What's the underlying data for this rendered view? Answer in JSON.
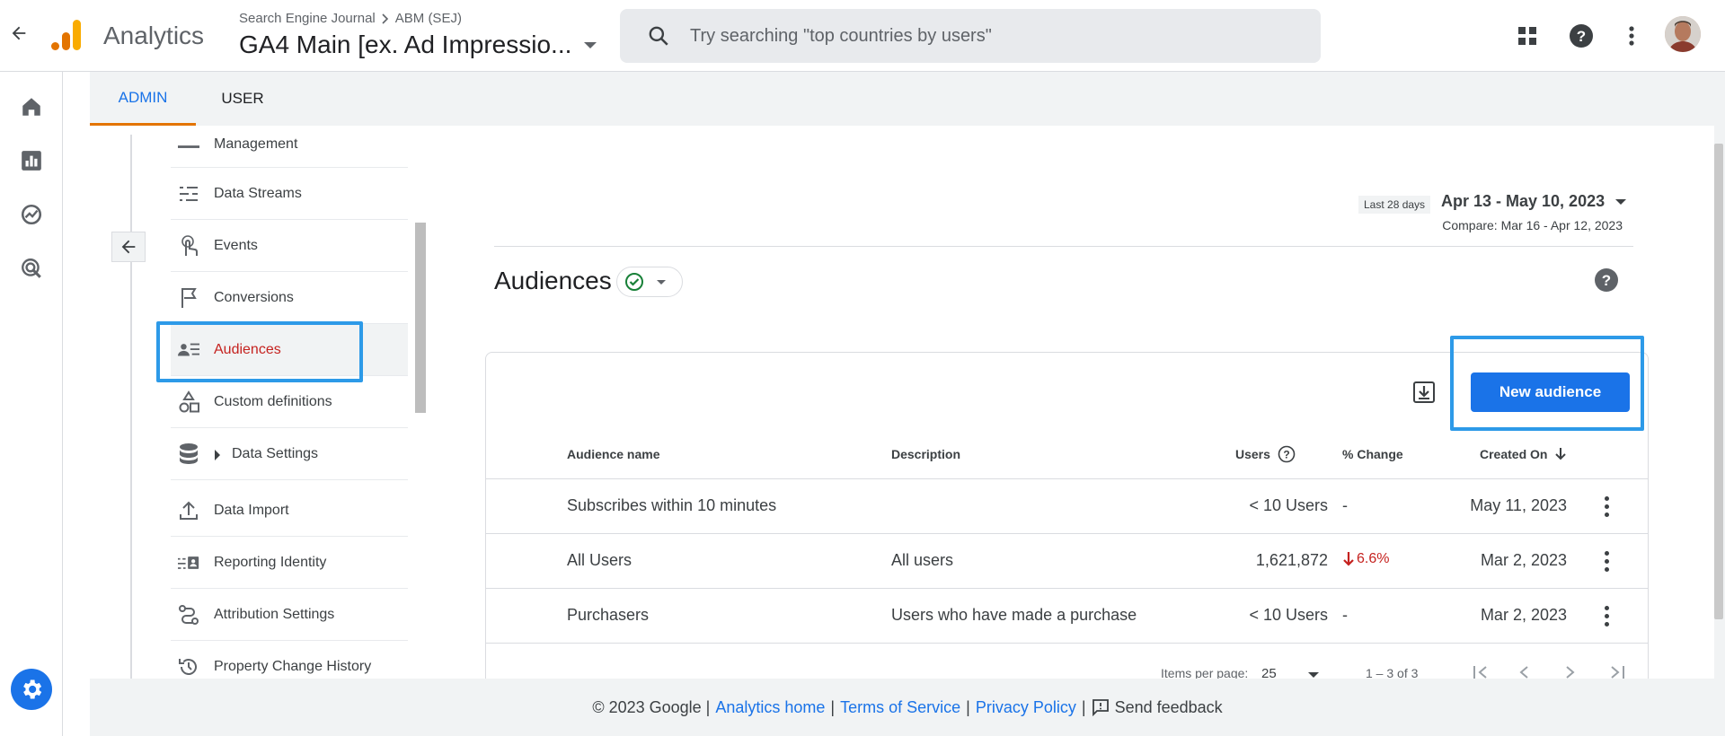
{
  "header": {
    "app_name": "Analytics",
    "breadcrumb_account": "Search Engine Journal",
    "breadcrumb_property": "ABM (SEJ)",
    "property_name": "GA4 Main [ex. Ad Impressio...",
    "search_placeholder": "Try searching \"top countries by users\"",
    "icons": [
      "back-arrow-icon",
      "apps-grid-icon",
      "help-icon",
      "more-vert-icon"
    ]
  },
  "tabs": [
    {
      "label": "ADMIN",
      "active": true
    },
    {
      "label": "USER",
      "active": false
    }
  ],
  "nav": {
    "items": [
      {
        "label": "Management",
        "icon": "management-icon"
      },
      {
        "label": "Data Streams",
        "icon": "data-streams-icon"
      },
      {
        "label": "Events",
        "icon": "touch-icon"
      },
      {
        "label": "Conversions",
        "icon": "flag-icon"
      },
      {
        "label": "Audiences",
        "icon": "audiences-icon",
        "selected": true
      },
      {
        "label": "Custom definitions",
        "icon": "shapes-icon"
      },
      {
        "label": "Data Settings",
        "icon": "database-icon"
      },
      {
        "label": "Data Import",
        "icon": "upload-icon"
      },
      {
        "label": "Reporting Identity",
        "icon": "reporting-identity-icon"
      },
      {
        "label": "Attribution Settings",
        "icon": "attribution-icon"
      },
      {
        "label": "Property Change History",
        "icon": "history-icon"
      }
    ]
  },
  "date": {
    "preset": "Last 28 days",
    "range": "Apr 13 - May 10, 2023",
    "compare": "Compare: Mar 16 - Apr 12, 2023"
  },
  "page": {
    "title": "Audiences",
    "new_button": "New audience"
  },
  "table": {
    "headers": {
      "name": "Audience name",
      "description": "Description",
      "users": "Users",
      "change": "% Change",
      "created": "Created On"
    },
    "rows": [
      {
        "name": "Subscribes within 10 minutes",
        "description": "",
        "users": "< 10 Users",
        "change": "-",
        "created": "May 11, 2023"
      },
      {
        "name": "All Users",
        "description": "All users",
        "users": "1,621,872",
        "change": "6.6%",
        "created": "Mar 2, 2023"
      },
      {
        "name": "Purchasers",
        "description": "Users who have made a purchase",
        "users": "< 10 Users",
        "change": "-",
        "created": "Mar 2, 2023"
      }
    ]
  },
  "pager": {
    "items_label": "Items per page:",
    "items_value": "25",
    "range": "1 – 3 of 3"
  },
  "footer": {
    "copyright": "© 2023 Google |",
    "analytics_home": "Analytics home",
    "terms": "Terms of Service",
    "privacy": "Privacy Policy",
    "sep": "|",
    "feedback": "Send feedback"
  },
  "colors": {
    "accent": "#1a73e8",
    "highlight": "#2d9ae8",
    "negative": "#c5221f",
    "tab_underline": "#e37400"
  }
}
